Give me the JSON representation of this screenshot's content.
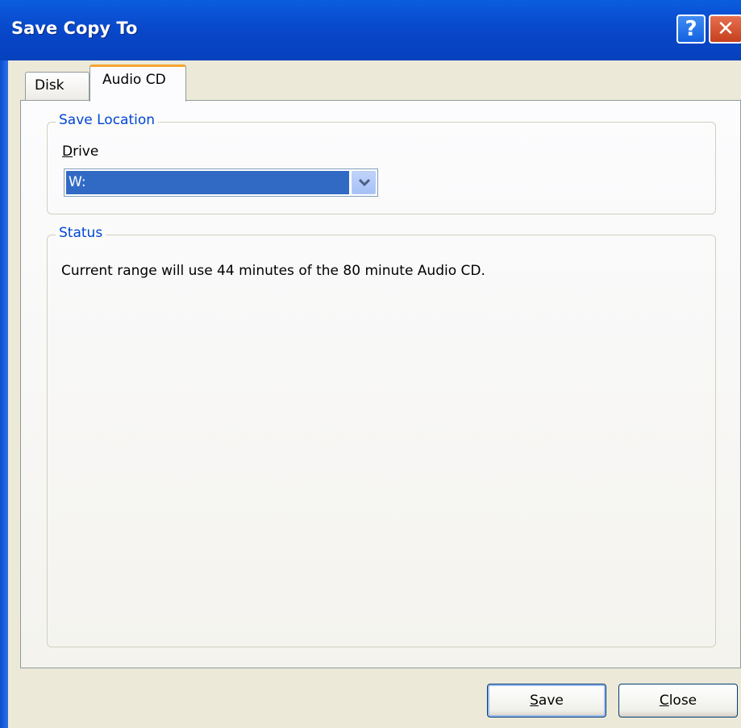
{
  "window": {
    "title": "Save Copy To",
    "help_glyph": "?",
    "close_glyph": "✕"
  },
  "tabs": [
    {
      "label": "Disk"
    },
    {
      "label": "Audio CD"
    }
  ],
  "save_location": {
    "legend": "Save Location",
    "drive_label_underlined": "D",
    "drive_label_rest": "rive",
    "drive_value": "W:"
  },
  "status": {
    "legend": "Status",
    "message": "Current range will use 44 minutes of the 80 minute Audio CD."
  },
  "buttons": {
    "save_underlined": "S",
    "save_rest": "ave",
    "close_underlined": "C",
    "close_rest": "lose"
  },
  "colors": {
    "title_bar": "#0a53d6",
    "selection": "#316ac5",
    "legend_text": "#0046d5",
    "tab_highlight": "#f5a531"
  }
}
